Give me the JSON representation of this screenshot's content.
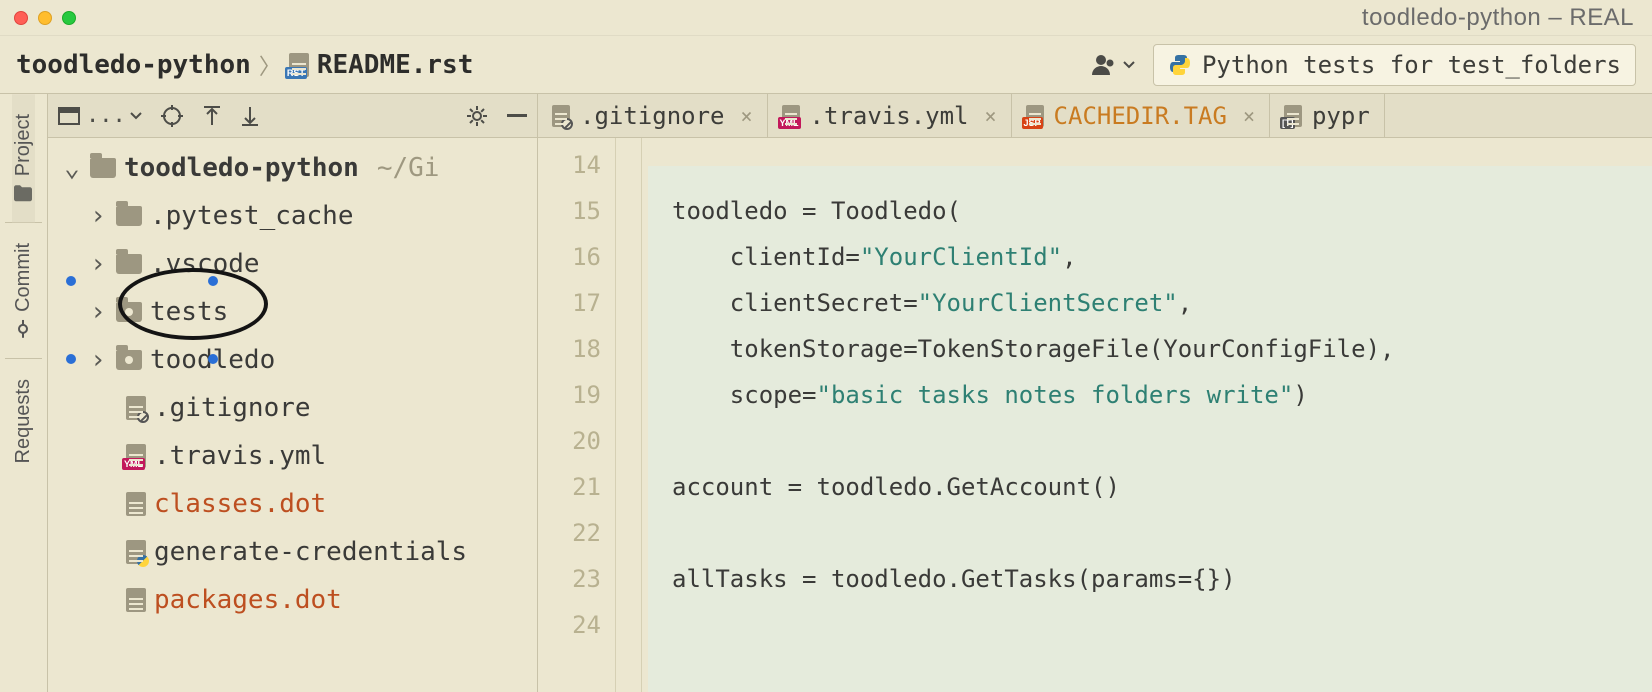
{
  "window": {
    "title": "toodledo-python – REAL"
  },
  "breadcrumb": {
    "root": "toodledo-python",
    "file": "README.rst"
  },
  "run_config": {
    "label": "Python tests for test_folders"
  },
  "rail": {
    "items": [
      {
        "label": "Project"
      },
      {
        "label": "Commit"
      },
      {
        "label": "Requests"
      }
    ]
  },
  "toolbar": {
    "dropdown": "..."
  },
  "tree": {
    "root": {
      "label": "toodledo-python",
      "path": "~/Gi"
    },
    "items": [
      {
        "label": ".pytest_cache",
        "type": "folder"
      },
      {
        "label": ".vscode",
        "type": "folder"
      },
      {
        "label": "tests",
        "type": "folder-dot"
      },
      {
        "label": "toodledo",
        "type": "folder-dot"
      },
      {
        "label": ".gitignore",
        "type": "file-ignore"
      },
      {
        "label": ".travis.yml",
        "type": "file-yml"
      },
      {
        "label": "classes.dot",
        "type": "file",
        "color": "orange"
      },
      {
        "label": "generate-credentials",
        "type": "file-py"
      },
      {
        "label": "packages.dot",
        "type": "file",
        "color": "orange"
      }
    ]
  },
  "tabs": [
    {
      "label": ".gitignore",
      "icon": "ignore"
    },
    {
      "label": ".travis.yml",
      "icon": "yml"
    },
    {
      "label": "CACHEDIR.TAG",
      "icon": "jsp",
      "color": "orange"
    },
    {
      "label": "pypr",
      "icon": "toml",
      "noclose": true
    }
  ],
  "gutter": {
    "start": 14,
    "end": 24
  },
  "code": {
    "l14": {
      "text": ""
    },
    "l15": {
      "a": "toodledo = Toodledo("
    },
    "l16": {
      "a": "    clientId=",
      "s": "\"YourClientId\"",
      "b": ","
    },
    "l17": {
      "a": "    clientSecret=",
      "s": "\"YourClientSecret\"",
      "b": ","
    },
    "l18": {
      "a": "    tokenStorage=TokenStorageFile(YourConfigFile),"
    },
    "l19": {
      "a": "    scope=",
      "s": "\"basic tasks notes folders write\"",
      "b": ")"
    },
    "l20": {
      "text": ""
    },
    "l21": {
      "a": "account = toodledo.GetAccount()"
    },
    "l22": {
      "text": ""
    },
    "l23": {
      "a": "allTasks = toodledo.GetTasks(params={})"
    },
    "l24": {
      "text": ""
    }
  }
}
